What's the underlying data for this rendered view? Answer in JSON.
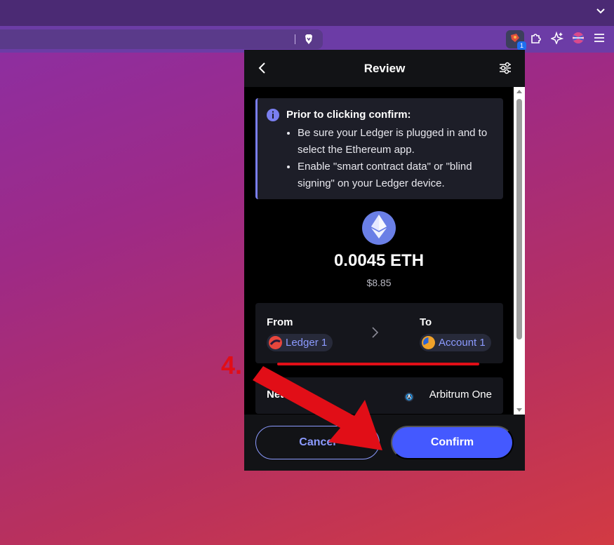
{
  "popup": {
    "title": "Review"
  },
  "notice": {
    "title": "Prior to clicking confirm:",
    "items": [
      "Be sure your Ledger is plugged in and to select the Ethereum app.",
      "Enable \"smart contract data\" or \"blind signing\" on your Ledger device."
    ]
  },
  "transaction": {
    "amount": "0.0045 ETH",
    "fiat": "$8.85"
  },
  "transfer": {
    "from_label": "From",
    "to_label": "To",
    "from_account": "Ledger 1",
    "to_account": "Account 1"
  },
  "network": {
    "label": "Network",
    "value": "Arbitrum One"
  },
  "footer": {
    "cancel_label": "Cancel",
    "confirm_label": "Confirm"
  },
  "browser": {
    "extension_badge": "1"
  },
  "annotation": {
    "step": "4."
  },
  "colors": {
    "accent": "#4459ff",
    "link": "#8c9bff",
    "annotation_red": "#e10e17"
  },
  "icons": [
    "chevron-down-icon",
    "brave-lion-icon",
    "wallet-extension-icon",
    "puzzle-icon",
    "sparkle-icon",
    "profile-flag-icon",
    "hamburger-menu-icon",
    "back-arrow-icon",
    "settings-sliders-icon",
    "info-icon",
    "ethereum-icon",
    "chevron-right-icon",
    "arbitrum-icon"
  ]
}
